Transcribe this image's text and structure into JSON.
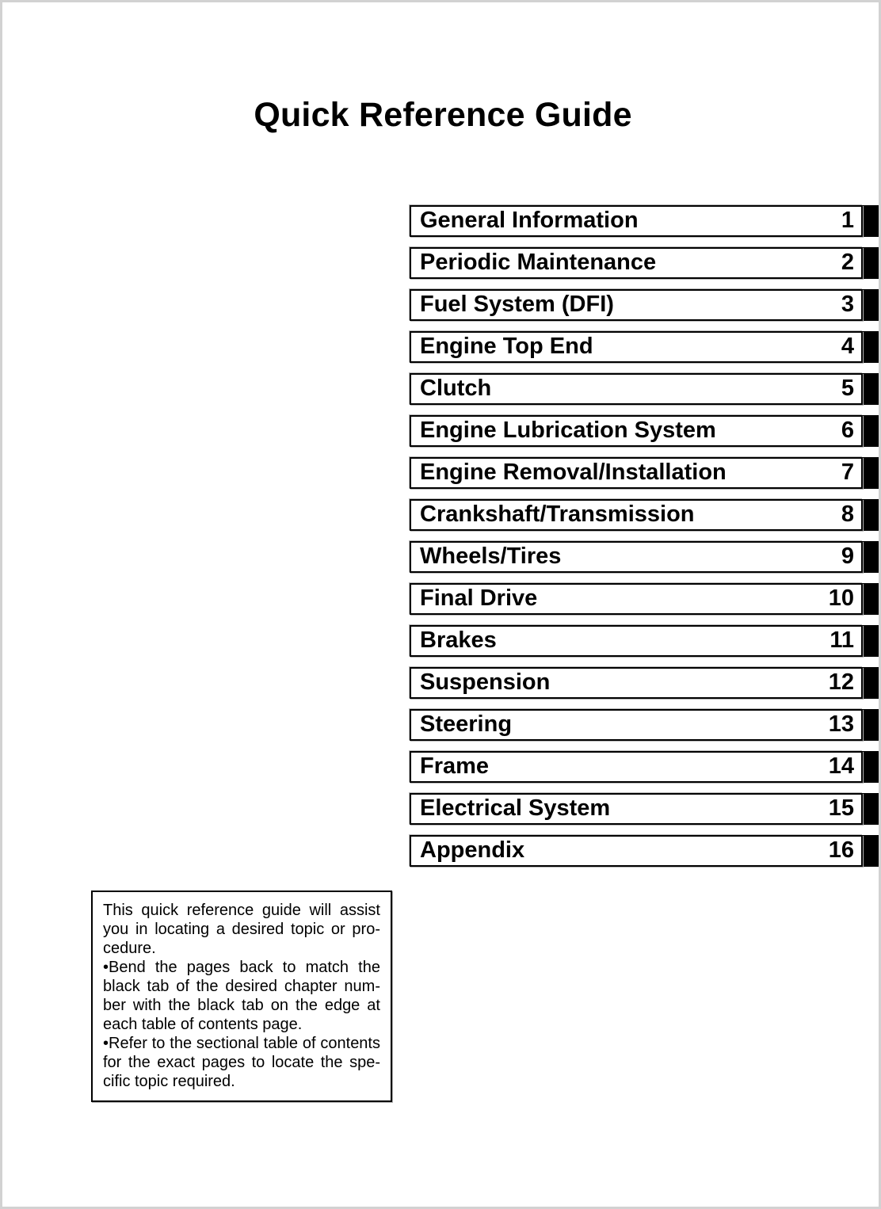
{
  "document": {
    "title": "Quick Reference Guide"
  },
  "chapter_index": {
    "rows": [
      {
        "title": "General Information",
        "number": "1"
      },
      {
        "title": "Periodic Maintenance",
        "number": "2"
      },
      {
        "title": "Fuel System (DFI)",
        "number": "3"
      },
      {
        "title": "Engine Top End",
        "number": "4"
      },
      {
        "title": "Clutch",
        "number": "5"
      },
      {
        "title": "Engine Lubrication System",
        "number": "6"
      },
      {
        "title": "Engine Removal/Installation",
        "number": "7"
      },
      {
        "title": "Crankshaft/Transmission",
        "number": "8"
      },
      {
        "title": "Wheels/Tires",
        "number": "9"
      },
      {
        "title": "Final Drive",
        "number": "10"
      },
      {
        "title": "Brakes",
        "number": "11"
      },
      {
        "title": "Suspension",
        "number": "12"
      },
      {
        "title": "Steering",
        "number": "13"
      },
      {
        "title": "Frame",
        "number": "14"
      },
      {
        "title": "Electrical System",
        "number": "15"
      },
      {
        "title": "Appendix",
        "number": "16"
      }
    ]
  },
  "note": {
    "intro_lines": [
      "This quick reference guide will assist",
      "you in locating a desired topic or pro-",
      "cedure."
    ],
    "bullets": [
      {
        "marker": "•",
        "lines": [
          "Bend the pages back to match the",
          "black tab of the desired chapter num-",
          "ber with the black tab on the edge at",
          "each table of contents page."
        ]
      },
      {
        "marker": "•",
        "lines": [
          "Refer to the sectional table of contents",
          "for the exact pages to locate the spe-",
          "cific topic required."
        ]
      }
    ]
  },
  "colors": {
    "ink": "#000000",
    "paper": "#ffffff",
    "page_border": "#d2d2d2",
    "tab_black": "#000000",
    "box_shadow": "#b8b8b8"
  }
}
